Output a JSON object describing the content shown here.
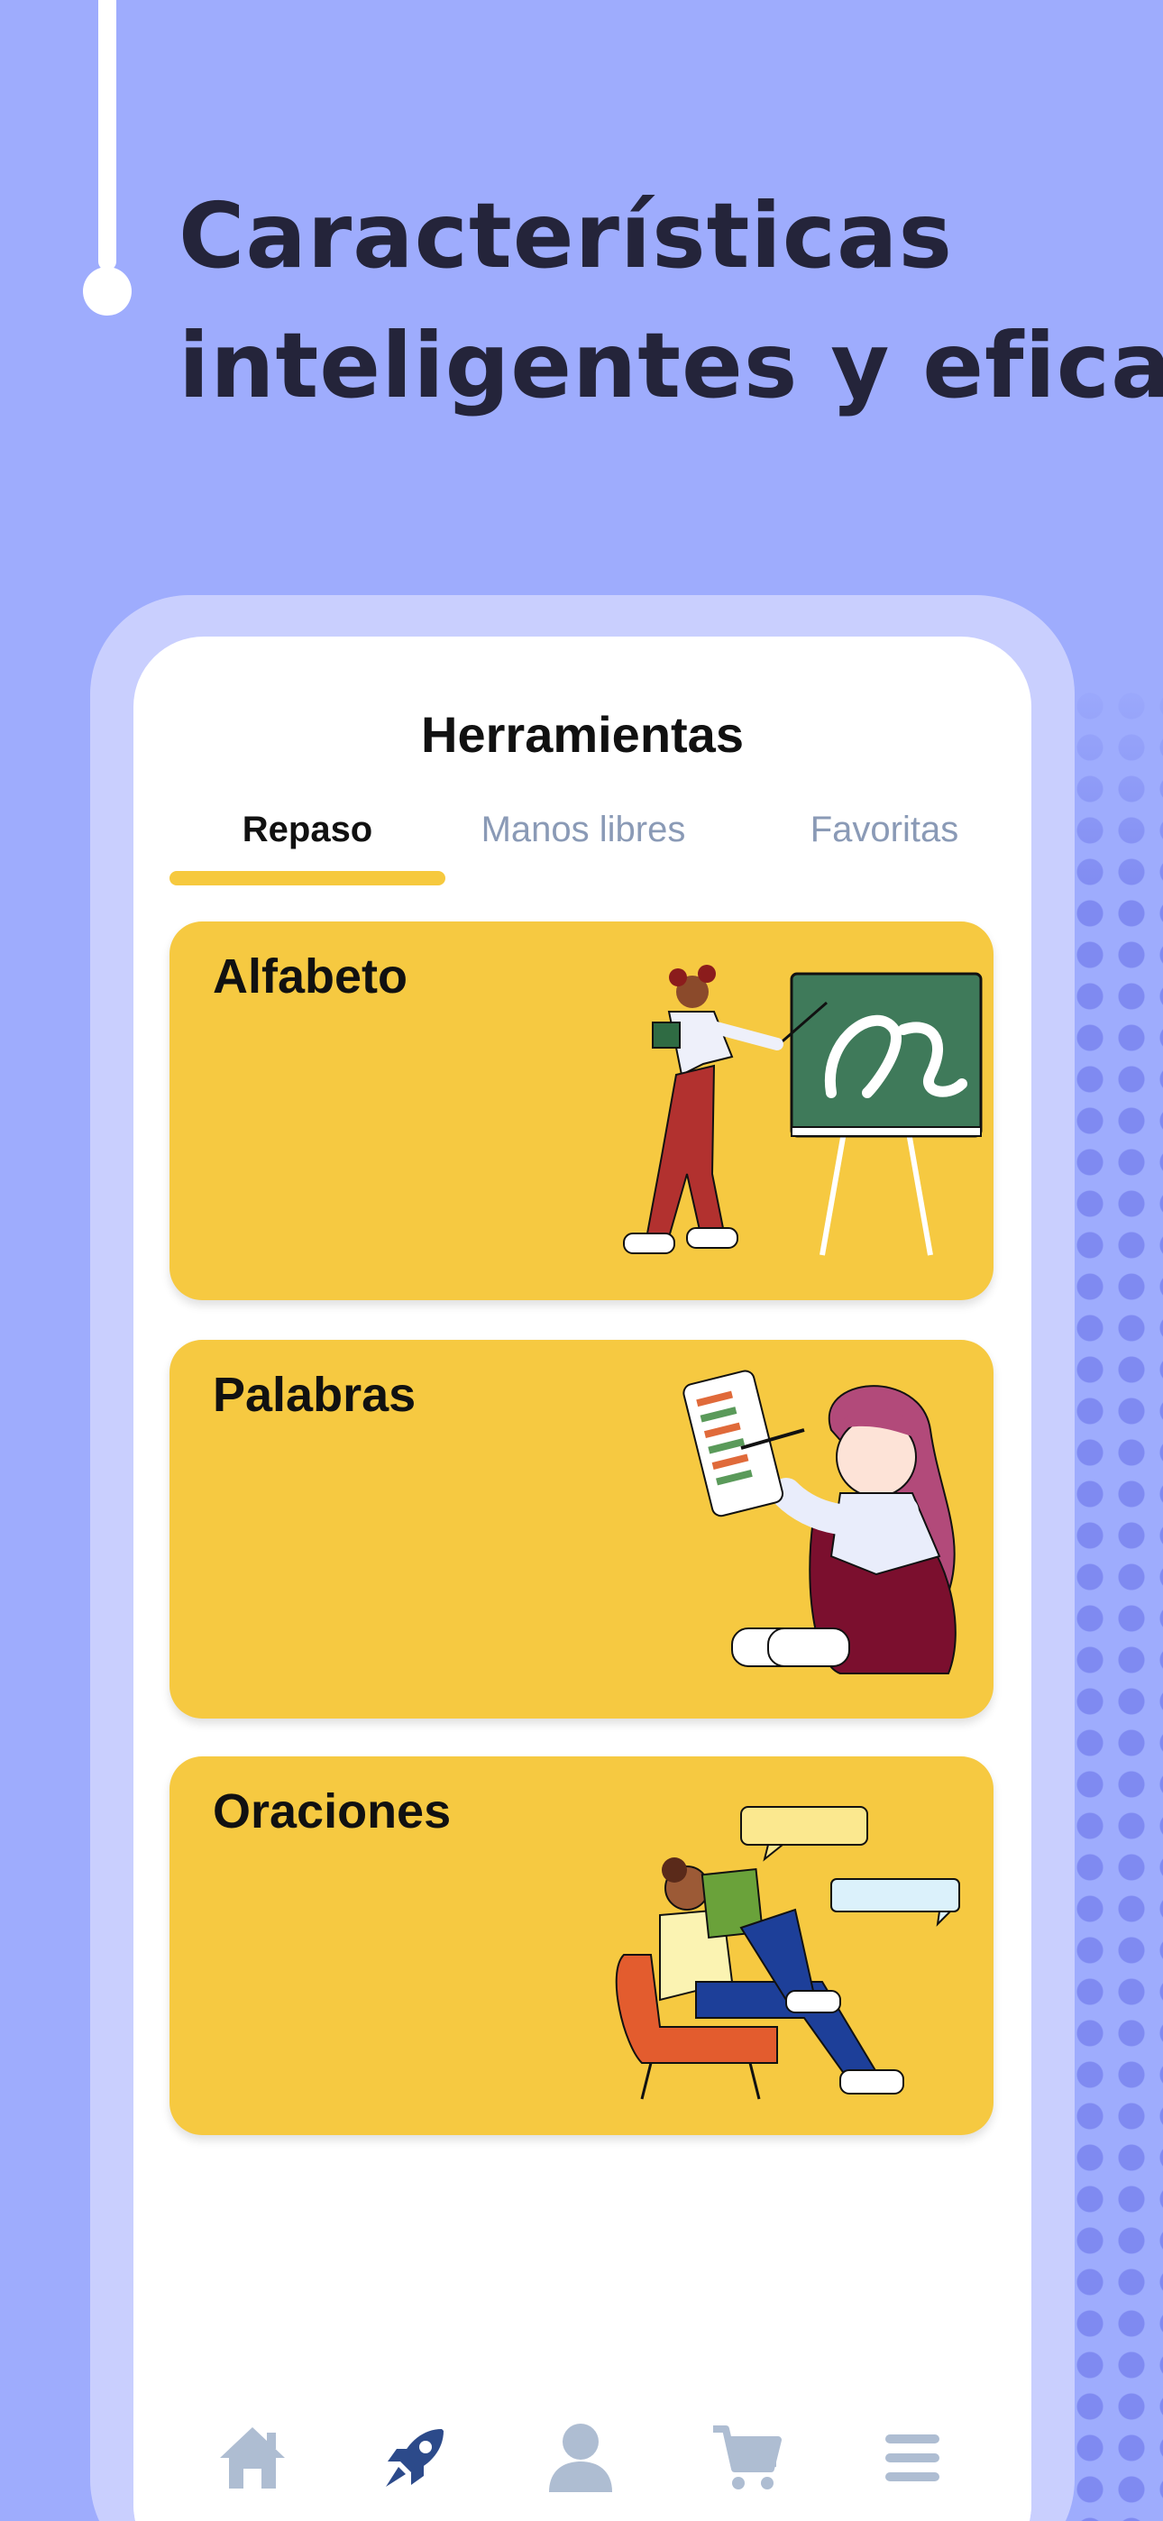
{
  "headline": {
    "line1": "Características",
    "line2": "inteligentes y eficaces"
  },
  "screen": {
    "title": "Herramientas",
    "tabs": [
      {
        "label": "Repaso",
        "active": true
      },
      {
        "label": "Manos libres",
        "active": false
      },
      {
        "label": "Favoritas",
        "active": false
      }
    ],
    "cards": [
      {
        "title": "Alfabeto",
        "illustration": "teacher-chalkboard-illustration"
      },
      {
        "title": "Palabras",
        "illustration": "girl-reading-list-illustration"
      },
      {
        "title": "Oraciones",
        "illustration": "person-reading-chair-illustration"
      }
    ]
  },
  "bottom_nav": {
    "items": [
      {
        "icon": "home-icon",
        "active": false
      },
      {
        "icon": "rocket-icon",
        "active": true
      },
      {
        "icon": "profile-icon",
        "active": false
      },
      {
        "icon": "cart-icon",
        "active": false
      },
      {
        "icon": "menu-icon",
        "active": false
      }
    ]
  },
  "colors": {
    "background": "#9eacfd",
    "card": "#f6c941",
    "accent": "#f6c93e",
    "nav_active": "#2c4a8a",
    "nav_inactive": "#aebdd2"
  }
}
